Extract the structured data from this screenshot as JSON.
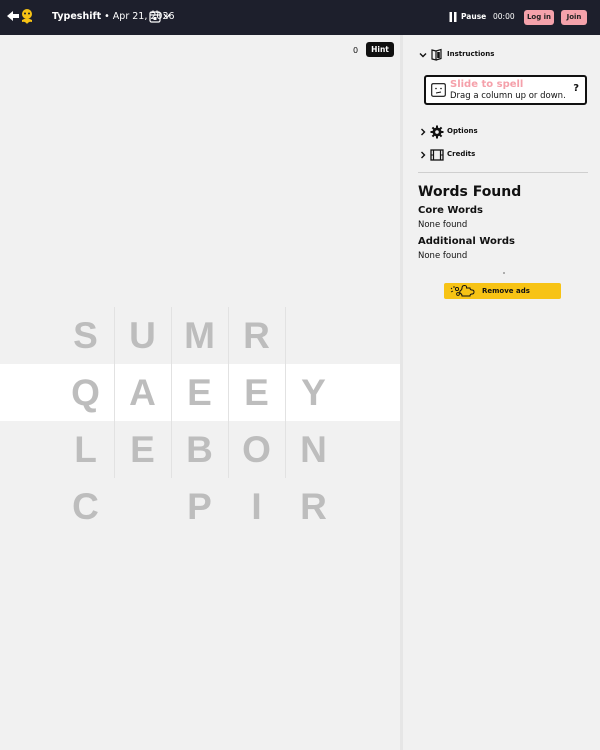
{
  "header": {
    "app_name": "Typeshift",
    "separator": " • ",
    "date": "Apr 21, 2026",
    "pause_label": "Pause",
    "timer": "00:00",
    "login_label": "Log in",
    "join_label": "Join"
  },
  "game": {
    "hint_count": "0",
    "hint_label": "Hint",
    "columns": [
      [
        "S",
        "Q",
        "L",
        "C"
      ],
      [
        "U",
        "A",
        "E",
        ""
      ],
      [
        "M",
        "E",
        "B",
        "P"
      ],
      [
        "R",
        "E",
        "O",
        "I"
      ],
      [
        "",
        "Y",
        "N",
        "R"
      ]
    ]
  },
  "panel": {
    "instructions_label": "Instructions",
    "instructions_title": "Slide to spell",
    "instructions_text": "Drag a column up or down.",
    "instructions_help": "?",
    "options_label": "Options",
    "credits_label": "Credits",
    "words_found_title": "Words Found",
    "core_words_title": "Core Words",
    "core_words_status": "None found",
    "additional_words_title": "Additional Words",
    "additional_words_status": "None found",
    "remove_ads_label": "Remove ads"
  },
  "colors": {
    "header_bg": "#1d1f2c",
    "accent_pink": "#f4a2ab",
    "tile_letter": "#bdbdbd",
    "ads_yellow": "#f7c315"
  }
}
